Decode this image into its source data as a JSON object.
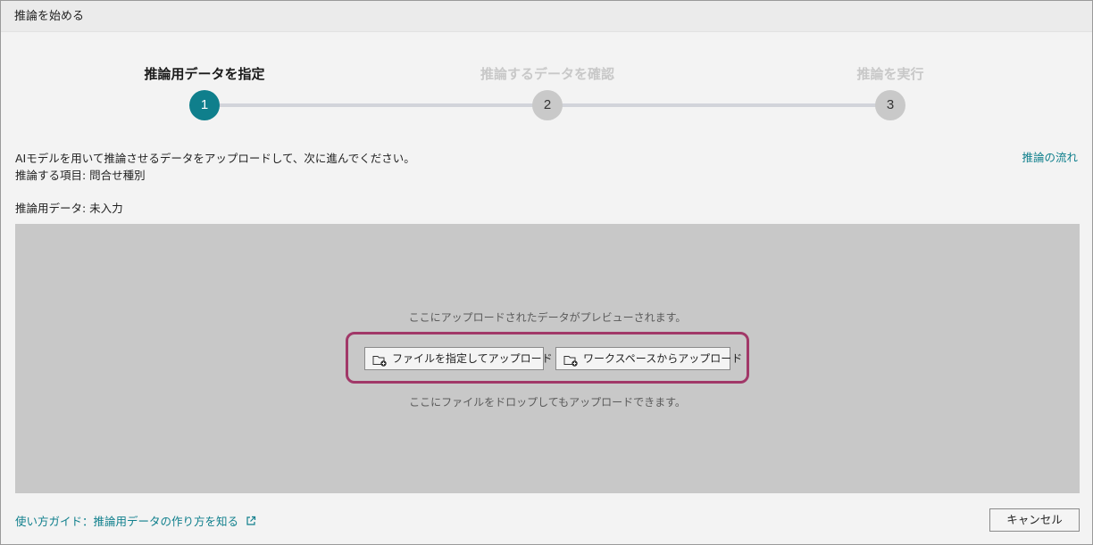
{
  "window": {
    "title": "推論を始める"
  },
  "stepper": {
    "steps": [
      {
        "number": "1",
        "label": "推論用データを指定",
        "state": "active"
      },
      {
        "number": "2",
        "label": "推論するデータを確認",
        "state": "inactive"
      },
      {
        "number": "3",
        "label": "推論を実行",
        "state": "inactive"
      }
    ]
  },
  "description": {
    "line1": "AIモデルを用いて推論させるデータをアップロードして、次に進んでください。",
    "line2": "推論する項目: 問合せ種別"
  },
  "flow_link": "推論の流れ",
  "data_status": "推論用データ: 未入力",
  "dropzone": {
    "preview_text": "ここにアップロードされたデータがプレビューされます。",
    "upload_file_label": "ファイルを指定してアップロード",
    "upload_workspace_label": "ワークスペースからアップロード",
    "drop_text": "ここにファイルをドロップしてもアップロードできます。"
  },
  "footer": {
    "guide_link": "使い方ガイド：推論用データの作り方を知る",
    "cancel_label": "キャンセル"
  },
  "colors": {
    "accent": "#0f7f8c",
    "highlight": "#a13868",
    "dropzone_bg": "#c8c8c8"
  },
  "icons": {
    "upload_file": "folder-upload-icon",
    "upload_workspace": "folder-upload-icon",
    "external_link": "external-link-icon"
  }
}
